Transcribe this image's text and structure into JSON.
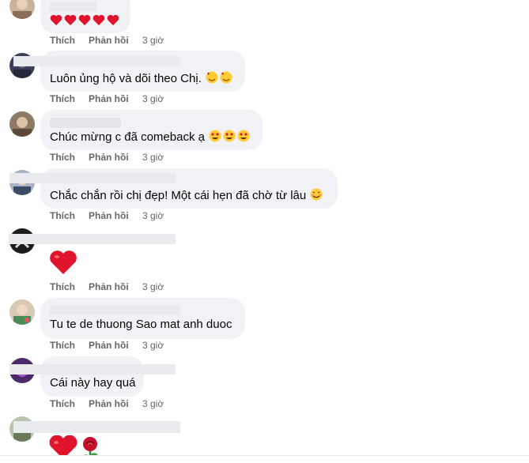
{
  "comments": [
    {
      "text": "",
      "emojis": "❤️❤️❤️❤️❤️",
      "like": "Thích",
      "reply": "Phản hồi",
      "time": "3 giờ"
    },
    {
      "text": "Luôn ủng hộ và dõi theo Chị.",
      "emojis": "🥰🥰",
      "like": "Thích",
      "reply": "Phản hồi",
      "time": "3 giờ"
    },
    {
      "text": "Chúc mừng c đã comeback ạ",
      "emojis": "😍😍😍",
      "like": "Thích",
      "reply": "Phản hồi",
      "time": "3 giờ"
    },
    {
      "text": "Chắc chắn rồi chị đẹp! Một cái hẹn đã chờ từ lâu",
      "emojis": "😊",
      "like": "Thích",
      "reply": "Phản hồi",
      "time": "3 giờ"
    },
    {
      "text": "",
      "emojis": "❤️",
      "like": "Thích",
      "reply": "Phản hồi",
      "time": "3 giờ"
    },
    {
      "text": "Tu te de thuong Sao mat anh duoc",
      "emojis": "",
      "like": "Thích",
      "reply": "Phản hồi",
      "time": "3 giờ"
    },
    {
      "text": "Cái này hay quá",
      "emojis": "",
      "like": "Thích",
      "reply": "Phản hồi",
      "time": "3 giờ"
    },
    {
      "text": "",
      "emojis": "❤️🌹",
      "like": "",
      "reply": "",
      "time": ""
    }
  ],
  "colors": {
    "bubble": "#f0f2f5",
    "meta": "#65676b",
    "text": "#050505",
    "heart": "#e0142d",
    "redaction": "#e9ebee"
  }
}
